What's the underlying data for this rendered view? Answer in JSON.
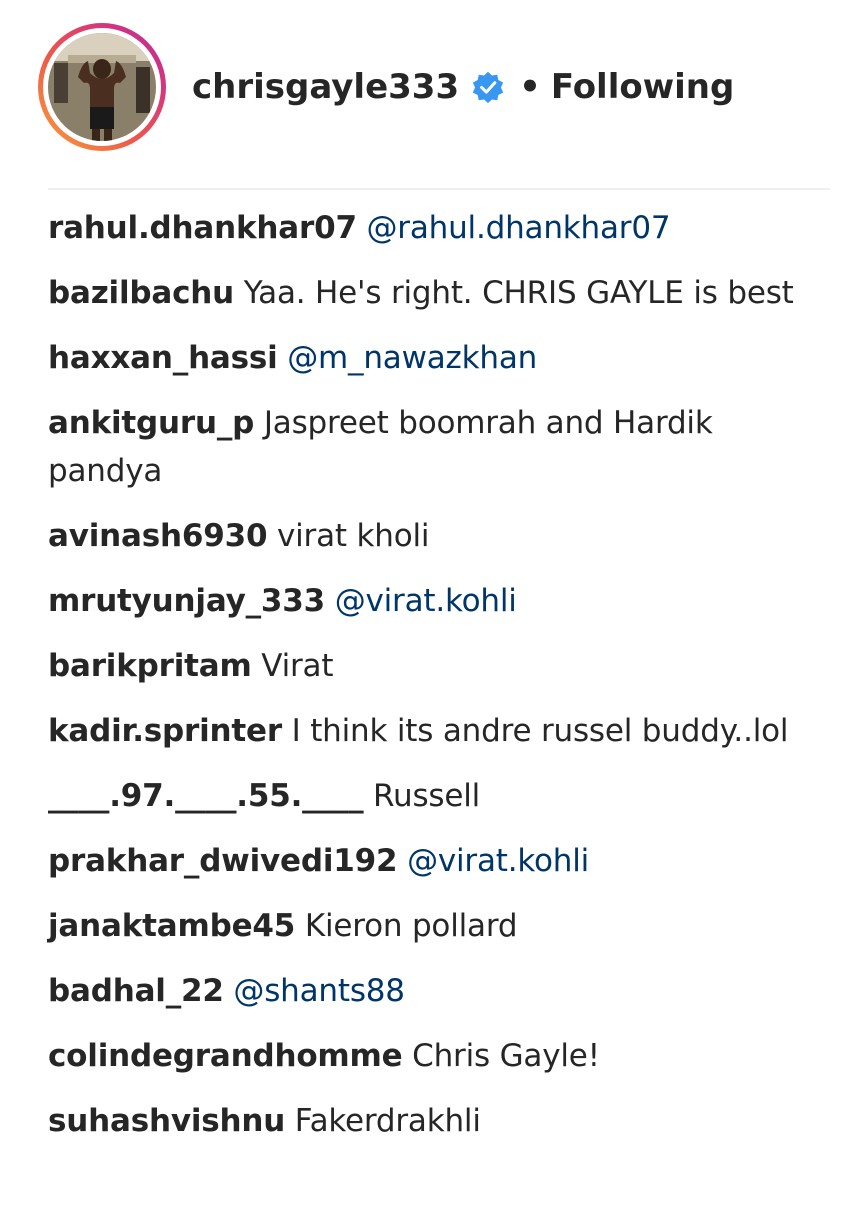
{
  "header": {
    "username": "chrisgayle333",
    "separator": "•",
    "follow_status": "Following"
  },
  "comments": [
    {
      "username": "rahul.dhankhar07",
      "text": "@rahul.dhankhar07"
    },
    {
      "username": "bazilbachu",
      "text": "Yaa. He's right. CHRIS GAYLE is best"
    },
    {
      "username": "haxxan_hassi",
      "text": "@m_nawazkhan"
    },
    {
      "username": "ankitguru_p",
      "text": "Jaspreet boomrah and Hardik pandya"
    },
    {
      "username": "avinash6930",
      "text": "virat kholi"
    },
    {
      "username": "mrutyunjay_333",
      "text": "@virat.kohli"
    },
    {
      "username": "barikpritam",
      "text": "Virat"
    },
    {
      "username": "kadir.sprinter",
      "text": "I think its andre russel buddy..lol"
    },
    {
      "username": "____.97.____.55.____",
      "text": "Russell"
    },
    {
      "username": "prakhar_dwivedi192",
      "text": "@virat.kohli"
    },
    {
      "username": "janaktambe45",
      "text": "Kieron pollard"
    },
    {
      "username": "badhal_22",
      "text": "@shants88"
    },
    {
      "username": "colindegrandhomme",
      "text": "Chris Gayle!"
    },
    {
      "username": "suhashvishnu",
      "text": "Fakerdrakhli"
    }
  ],
  "colors": {
    "text": "#262626",
    "mention": "#003569",
    "verified": "#3897f0",
    "divider": "#efefef"
  }
}
